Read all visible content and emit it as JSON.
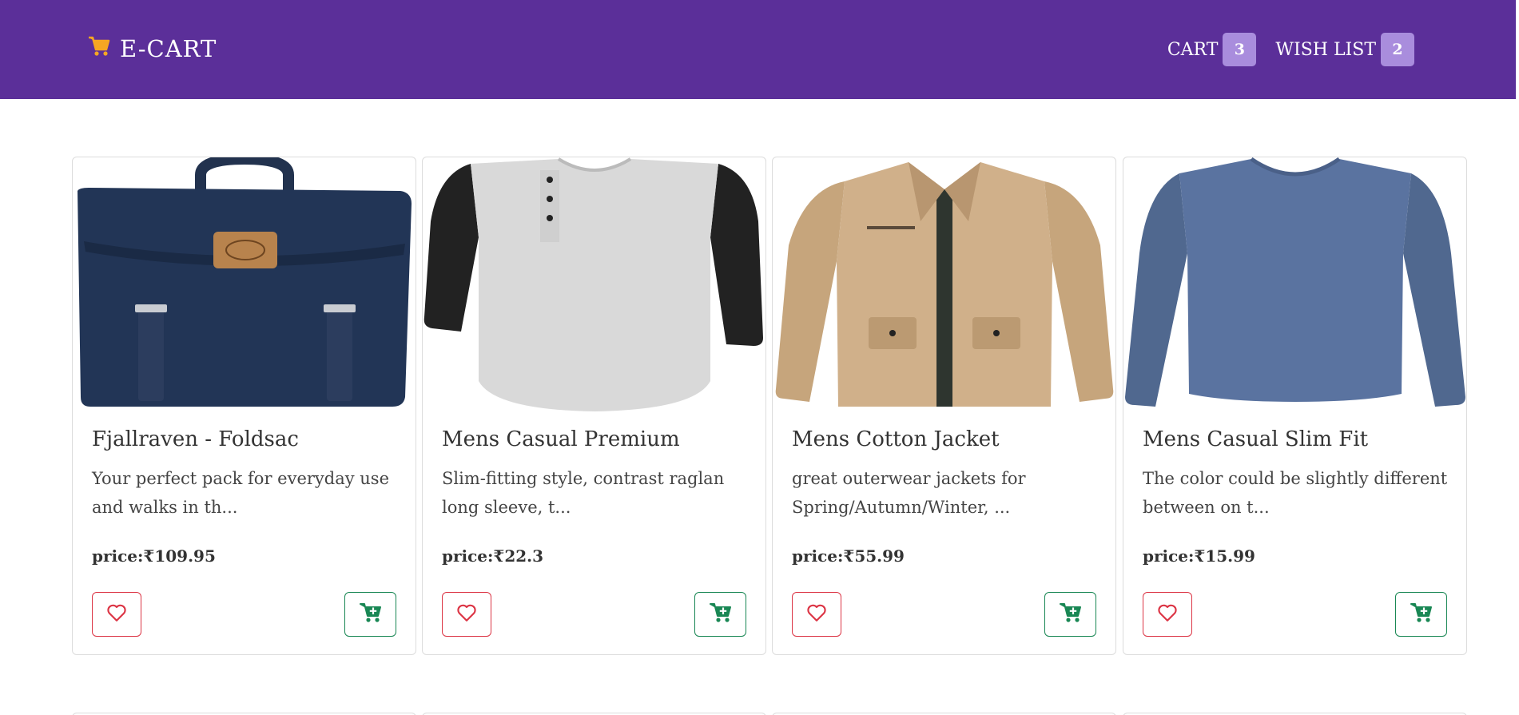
{
  "navbar": {
    "brand": "E-CART",
    "cart_label": "CART",
    "cart_count": "3",
    "wishlist_label": "WISH LIST",
    "wishlist_count": "2",
    "brand_icon_color": "#f5a623",
    "background_color": "#5b2f99"
  },
  "products": [
    {
      "title": "Fjallraven - Foldsac",
      "description": "Your perfect pack for everyday use and walks in th...",
      "price": "price:₹109.95",
      "image_icon": "backpack-image"
    },
    {
      "title": "Mens Casual Premium",
      "description": "Slim-fitting style, contrast raglan long sleeve, t...",
      "price": "price:₹22.3",
      "image_icon": "raglan-tshirt-image"
    },
    {
      "title": "Mens Cotton Jacket",
      "description": "great outerwear jackets for Spring/Autumn/Winter, ...",
      "price": "price:₹55.99",
      "image_icon": "jacket-image"
    },
    {
      "title": "Mens Casual Slim Fit",
      "description": "The color could be slightly different between on t...",
      "price": "price:₹15.99",
      "image_icon": "long-sleeve-shirt-image"
    }
  ],
  "buttons": {
    "wishlist_icon": "heart-icon",
    "add_to_cart_icon": "cart-plus-icon",
    "wishlist_color": "#dc3545",
    "cart_color": "#198754"
  }
}
